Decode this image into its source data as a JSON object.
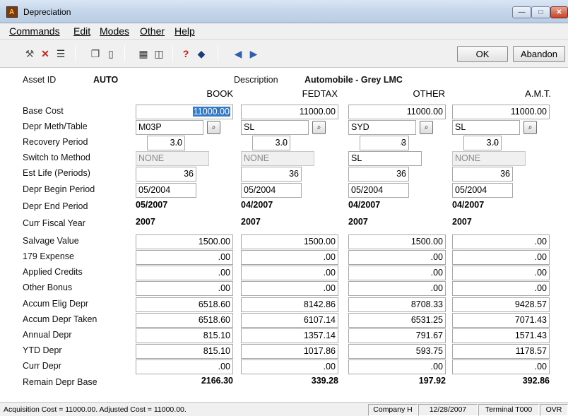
{
  "window": {
    "title": "Depreciation"
  },
  "menu": {
    "items": [
      "Commands",
      "Edit",
      "Modes",
      "Other",
      "Help"
    ]
  },
  "toolbar": {
    "ok_label": "OK",
    "abandon_label": "Abandon"
  },
  "header": {
    "asset_id_label": "Asset ID",
    "asset_id": "AUTO",
    "description_label": "Description",
    "description": "Automobile - Grey LMC"
  },
  "columns": [
    "BOOK",
    "FEDTAX",
    "OTHER",
    "A.M.T."
  ],
  "row_labels": {
    "base_cost": "Base Cost",
    "depr_meth": "Depr Meth/Table",
    "recovery": "Recovery Period",
    "switch": "Switch to Method",
    "est_life": "Est Life (Periods)",
    "begin": "Depr Begin Period",
    "end": "Depr End Period",
    "fiscal": "Curr Fiscal Year",
    "salvage": "Salvage Value",
    "e179": "179 Expense",
    "credits": "Applied Credits",
    "bonus": "Other Bonus",
    "accum_elig": "Accum Elig Depr",
    "accum_taken": "Accum Depr Taken",
    "annual": "Annual Depr",
    "ytd": "YTD Depr",
    "curr": "Curr Depr",
    "remain": "Remain Depr Base"
  },
  "book": {
    "base_cost": "11000.00",
    "depr_meth": "M03P",
    "recovery": "3.0",
    "switch": "NONE",
    "est_life": "36",
    "begin": "05/2004",
    "end": "05/2007",
    "fiscal": "2007",
    "salvage": "1500.00",
    "e179": ".00",
    "credits": ".00",
    "bonus": ".00",
    "accum_elig": "6518.60",
    "accum_taken": "6518.60",
    "annual": "815.10",
    "ytd": "815.10",
    "curr": ".00",
    "remain": "2166.30"
  },
  "fedtax": {
    "base_cost": "11000.00",
    "depr_meth": "SL",
    "recovery": "3.0",
    "switch": "NONE",
    "est_life": "36",
    "begin": "05/2004",
    "end": "04/2007",
    "fiscal": "2007",
    "salvage": "1500.00",
    "e179": ".00",
    "credits": ".00",
    "bonus": ".00",
    "accum_elig": "8142.86",
    "accum_taken": "6107.14",
    "annual": "1357.14",
    "ytd": "1017.86",
    "curr": ".00",
    "remain": "339.28"
  },
  "other": {
    "base_cost": "11000.00",
    "depr_meth": "SYD",
    "recovery": "3",
    "switch": "SL",
    "est_life": "36",
    "begin": "05/2004",
    "end": "04/2007",
    "fiscal": "2007",
    "salvage": "1500.00",
    "e179": ".00",
    "credits": ".00",
    "bonus": ".00",
    "accum_elig": "8708.33",
    "accum_taken": "6531.25",
    "annual": "791.67",
    "ytd": "593.75",
    "curr": ".00",
    "remain": "197.92"
  },
  "amt": {
    "base_cost": "11000.00",
    "depr_meth": "SL",
    "recovery": "3.0",
    "switch": "NONE",
    "est_life": "36",
    "begin": "05/2004",
    "end": "04/2007",
    "fiscal": "2007",
    "salvage": ".00",
    "e179": ".00",
    "credits": ".00",
    "bonus": ".00",
    "accum_elig": "9428.57",
    "accum_taken": "7071.43",
    "annual": "1571.43",
    "ytd": "1178.57",
    "curr": ".00",
    "remain": "392.86"
  },
  "status": {
    "message": "Acquisition Cost = 11000.00.  Adjusted Cost = 11000.00.",
    "company": "Company H",
    "date": "12/28/2007",
    "terminal": "Terminal T000",
    "mode": "OVR"
  }
}
